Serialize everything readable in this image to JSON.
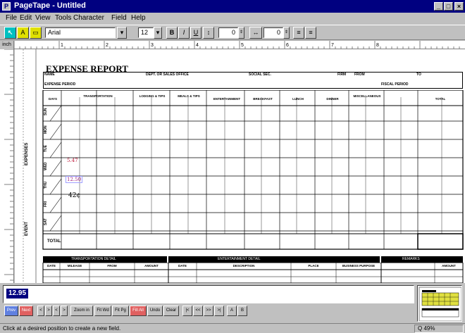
{
  "window": {
    "title": "PageTape - Untitled",
    "minimize": "_",
    "maximize": "□",
    "close": "×"
  },
  "menu": [
    "File",
    "Edit",
    "View",
    "Tools",
    "Character",
    "Field",
    "Help"
  ],
  "toolbar": {
    "font_name": "Arial",
    "font_size": "12",
    "bold": "B",
    "italic": "I",
    "underline": "U",
    "spacing_value": "0",
    "kerning_value": "0"
  },
  "ruler": {
    "corner_label": "inch",
    "marks": [
      "1",
      "2",
      "3",
      "4",
      "5",
      "6",
      "7",
      "8"
    ]
  },
  "form": {
    "title": "EXPENSE REPORT",
    "header_labels": [
      "NAME",
      "DEPT. OR SALES OFFICE",
      "SOCIAL SEC.",
      "FIRM",
      "FROM",
      "TO",
      "EXPENSE PERIOD",
      "FISCAL PERIOD"
    ],
    "columns": [
      "DAYS",
      "TRANSPORTATION",
      "LODGING & TIPS",
      "MEALS & TIPS",
      "ENTERTAINMENT",
      "BREAKFAST",
      "LUNCH",
      "DINNER",
      "MISCELLANEOUS",
      "TOTAL"
    ],
    "days": [
      "SUN",
      "MON",
      "TUE",
      "WED",
      "THU",
      "FRI",
      "SAT"
    ],
    "total_label": "TOTAL",
    "side_labels": [
      "EXPENSES",
      "EVENT"
    ],
    "handwritten": [
      "5.47",
      "12.50",
      "42¢"
    ],
    "bottom_sections": [
      "TRANSPORTATION DETAIL",
      "ENTERTAINMENT DETAIL",
      "REMARKS"
    ],
    "bottom_columns": [
      "DATE",
      "MILEAGE",
      "FROM",
      "AMOUNT",
      "DATE",
      "DESCRIPTION",
      "PLACE",
      "BUSINESS PURPOSE",
      "AMOUNT"
    ]
  },
  "edit_pane": {
    "value": "12.95"
  },
  "bottom_tools": [
    "Prev",
    "Next",
    "<",
    ">",
    "<",
    ">",
    "Zoom in",
    "Fit Wd",
    "Fit Pg",
    "Fill All",
    "Undo",
    "Clear",
    "|<",
    "<<",
    ">>",
    ">|",
    "A",
    "B"
  ],
  "status": {
    "message": "Click at a desired position to create a new field.",
    "zoom": "Q 49%"
  },
  "colors": {
    "titlebar": "#000080",
    "selection": "#000080",
    "accent_cyan": "#00c0c0"
  }
}
